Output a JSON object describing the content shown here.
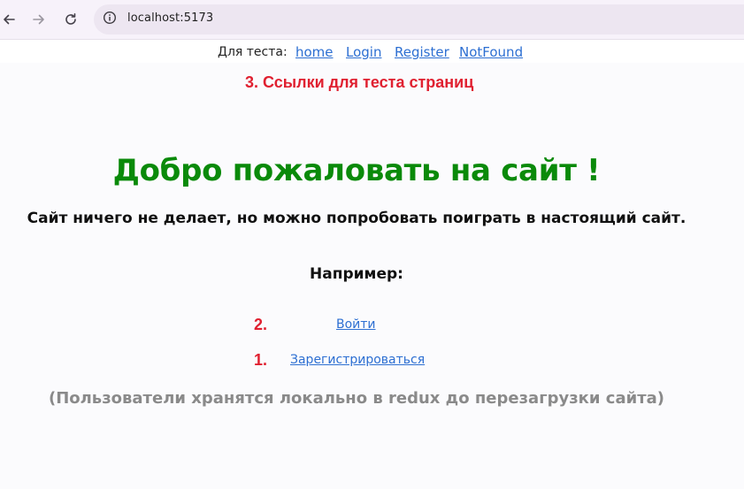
{
  "browser": {
    "url": "localhost:5173",
    "icons": {
      "back": "arrow-left-icon",
      "forward": "arrow-right-icon",
      "reload": "reload-icon",
      "site_info": "info-circle-icon"
    }
  },
  "test_nav": {
    "label": "Для теста:",
    "links": {
      "home": "home",
      "login": "Login",
      "register": "Register",
      "notfound": "NotFound"
    }
  },
  "annotations": {
    "a3": "3. Ссылки для теста страниц",
    "a2": "2.",
    "a1": "1."
  },
  "main": {
    "title": "Добро пожаловать на сайт !",
    "subtitle": "Сайт ничего не делает, но можно попробовать поиграть в настоящий сайт.",
    "example_label": "Например:",
    "login_link": "Войти",
    "register_link": "Зарегистрироваться",
    "note": "(Пользователи хранятся локально в redux до перезагрузки сайта)"
  },
  "colors": {
    "title_green": "#0a8a0a",
    "annotation_red": "#e02030",
    "link_blue": "#2d6fd2",
    "note_gray": "#8a8a8a",
    "browser_bar": "#f7f2fa",
    "omnibox": "#ede6f1"
  }
}
